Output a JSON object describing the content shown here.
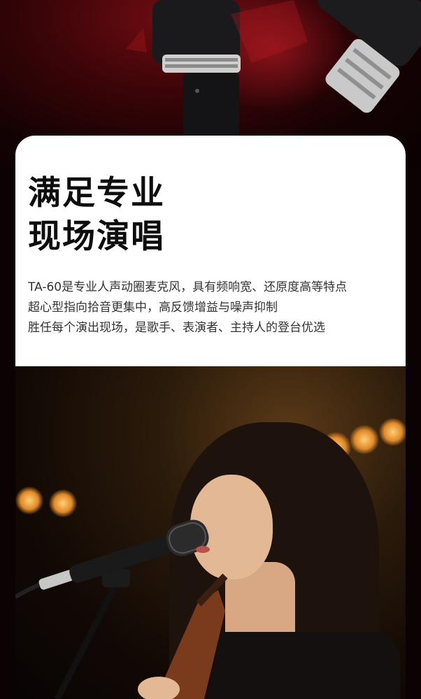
{
  "headline": {
    "line1": "满足专业",
    "line2": "现场演唱"
  },
  "description": {
    "line1": "TA-60是专业人声动圈麦克风，具有频响宽、还原度高等特点",
    "line2": "超心型指向拾音更集中，高反馈增益与噪声抑制",
    "line3": "胜任每个演出现场，是歌手、表演者、主持人的登台优选"
  },
  "colors": {
    "background": "#0a0203",
    "hero_red": "#6e0c12",
    "card": "#ffffff",
    "headline_text": "#0d0d0d",
    "body_text": "#333333",
    "bokeh": "#ffcf73"
  }
}
